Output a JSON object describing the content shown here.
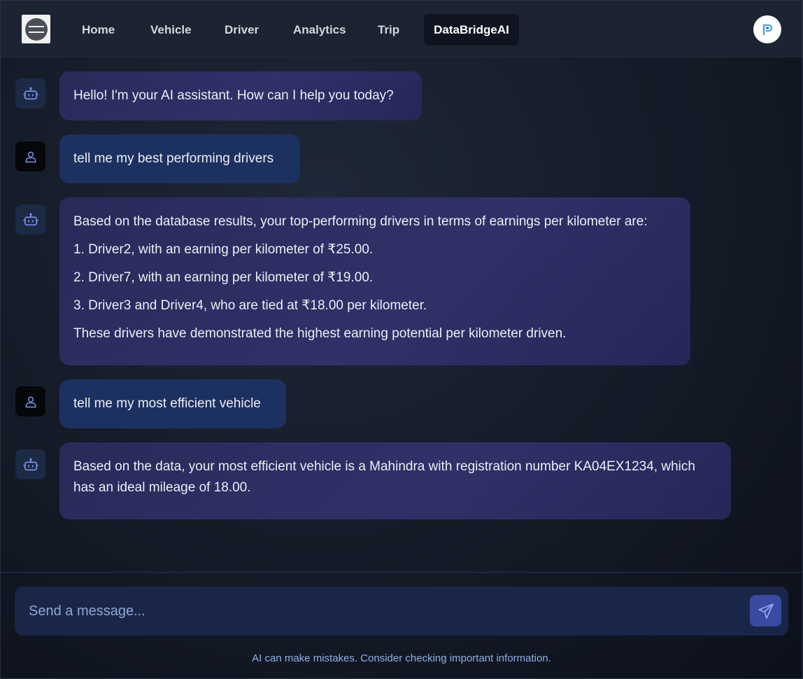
{
  "nav": {
    "items": [
      "Home",
      "Vehicle",
      "Driver",
      "Analytics",
      "Trip",
      "DataBridgeAI"
    ],
    "active_index": 5
  },
  "messages": [
    {
      "role": "bot",
      "lines": [
        "Hello! I'm your AI assistant. How can I help you today?"
      ]
    },
    {
      "role": "user",
      "lines": [
        "tell me my best performing drivers"
      ]
    },
    {
      "role": "bot",
      "lines": [
        "Based on the database results, your top-performing drivers in terms of earnings per kilometer are:",
        "1. Driver2, with an earning per kilometer of ₹25.00.",
        "2. Driver7, with an earning per kilometer of ₹19.00.",
        "3. Driver3 and Driver4, who are tied at ₹18.00 per kilometer.",
        "These drivers have demonstrated the highest earning potential per kilometer driven."
      ]
    },
    {
      "role": "user",
      "lines": [
        "tell me my most efficient vehicle"
      ]
    },
    {
      "role": "bot",
      "lines": [
        "Based on the data, your most efficient vehicle is a Mahindra with registration number KA04EX1234, which has an ideal mileage of 18.00."
      ]
    }
  ],
  "input": {
    "placeholder": "Send a message...",
    "value": ""
  },
  "disclaimer": "AI can make mistakes. Consider checking important information.",
  "colors": {
    "accent": "#3a4aa0",
    "bot_bubble": "#2f3168",
    "user_bubble": "#1d3160",
    "icon": "#7f95e8"
  },
  "icons": {
    "bot": "robot-icon",
    "user": "user-icon",
    "send": "send-icon",
    "profile": "profile-logo-icon"
  }
}
